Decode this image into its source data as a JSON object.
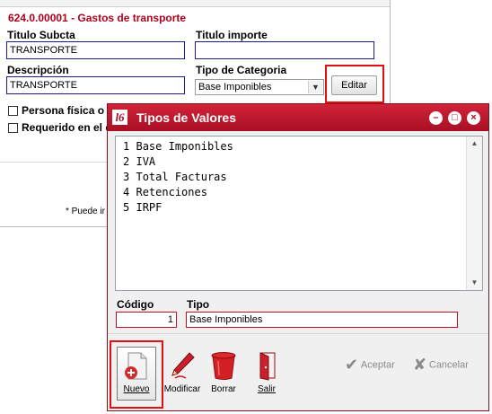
{
  "background_form": {
    "header": "624.0.00001 - Gastos de transporte",
    "titulo_subcta_label": "Titulo Subcta",
    "titulo_subcta_value": "TRANSPORTE",
    "titulo_importe_label": "Titulo importe",
    "titulo_importe_value": "",
    "descripcion_label": "Descripción",
    "descripcion_value": "TRANSPORTE",
    "tipo_categoria_label": "Tipo de Categoria",
    "tipo_categoria_value": "Base Imponibles",
    "editar_label": "Editar",
    "checkbox_persona_label": "Persona física o j",
    "checkbox_requerido_label": "Requerido en el c",
    "footnote": "* Puede ir"
  },
  "dialog": {
    "title": "Tipos de Valores",
    "logo_glyph": "l6",
    "items": [
      {
        "num": "1",
        "label": "Base Imponibles"
      },
      {
        "num": "2",
        "label": "IVA"
      },
      {
        "num": "3",
        "label": "Total Facturas"
      },
      {
        "num": "4",
        "label": "Retenciones"
      },
      {
        "num": "5",
        "label": "IRPF"
      }
    ],
    "codigo_label": "Código",
    "codigo_value": "1",
    "tipo_label": "Tipo",
    "tipo_value": "Base Imponibles",
    "toolbar": {
      "nuevo": "Nuevo",
      "modificar": "Modificar",
      "borrar": "Borrar",
      "salir": "Salir",
      "aceptar": "Aceptar",
      "cancelar": "Cancelar"
    }
  },
  "colors": {
    "accent_red": "#b0001c",
    "titlebar": "#c01a30",
    "highlight_box": "#e01010",
    "disabled_text": "#8a8a8a"
  },
  "icons": {
    "nuevo": "new-document-plus-icon",
    "modificar": "pen-icon",
    "borrar": "trash-bin-icon",
    "salir": "exit-door-icon",
    "aceptar": "checkmark-icon",
    "cancelar": "x-mark-icon"
  }
}
